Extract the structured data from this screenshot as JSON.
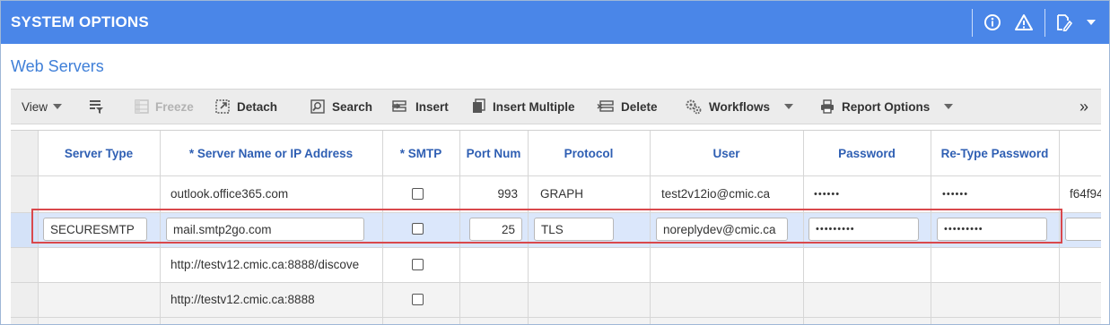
{
  "header": {
    "title": "SYSTEM OPTIONS"
  },
  "section": {
    "title": "Web Servers"
  },
  "toolbar": {
    "view": "View",
    "freeze": "Freeze",
    "detach": "Detach",
    "search": "Search",
    "insert": "Insert",
    "insert_multiple": "Insert Multiple",
    "delete": "Delete",
    "workflows": "Workflows",
    "report_options": "Report Options",
    "more": "»"
  },
  "columns": [
    "Server Type",
    "* Server Name or IP Address",
    "* SMTP",
    "Port Num",
    "Protocol",
    "User",
    "Password",
    "Re-Type Password"
  ],
  "rows": [
    {
      "server_type": "",
      "server_name": "outlook.office365.com",
      "smtp": false,
      "port": "993",
      "protocol": "GRAPH",
      "user": "test2v12io@cmic.ca",
      "password": "••••••",
      "retype": "••••••",
      "extra": "f64f94"
    },
    {
      "server_type": "SECURESMTP",
      "server_name": "mail.smtp2go.com",
      "smtp": false,
      "port": "25",
      "protocol": "TLS",
      "user": "noreplydev@cmic.ca",
      "password": "•••••••••",
      "retype": "•••••••••",
      "extra": ""
    },
    {
      "server_type": "",
      "server_name": "http://testv12.cmic.ca:8888/discove",
      "smtp": false,
      "port": "",
      "protocol": "",
      "user": "",
      "password": "",
      "retype": "",
      "extra": ""
    },
    {
      "server_type": "",
      "server_name": "http://testv12.cmic.ca:8888",
      "smtp": false,
      "port": "",
      "protocol": "",
      "user": "",
      "password": "",
      "retype": "",
      "extra": ""
    }
  ],
  "colors": {
    "header_bg": "#4a86e8",
    "column_header_text": "#2f5fb3",
    "selected_row": "#dbe7fb",
    "selection_outline": "#d9484c"
  }
}
